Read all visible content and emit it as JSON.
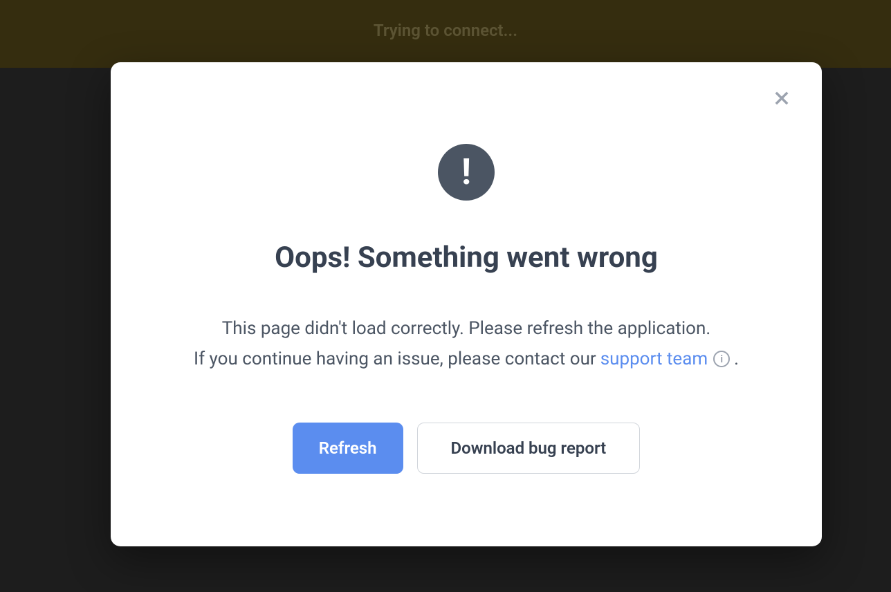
{
  "banner": {
    "text": "Trying to connect..."
  },
  "modal": {
    "title": "Oops! Something went wrong",
    "body_line1": "This page didn't load correctly. Please refresh the application.",
    "body_line2_prefix": "If you continue having an issue, please contact our",
    "support_link_text": "support team",
    "body_line2_suffix": ".",
    "buttons": {
      "refresh": "Refresh",
      "download_report": "Download bug report"
    }
  }
}
